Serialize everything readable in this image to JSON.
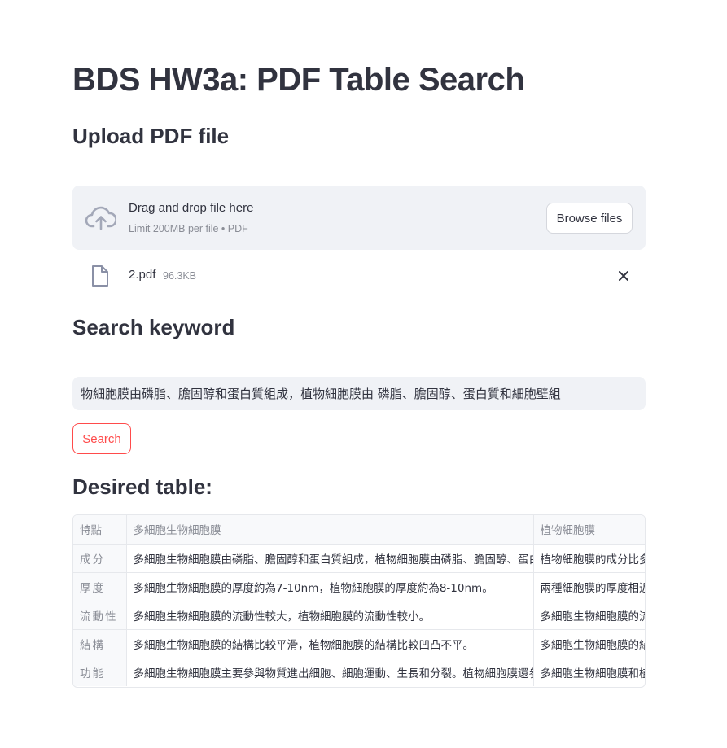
{
  "title": "BDS HW3a: PDF Table Search",
  "upload": {
    "heading": "Upload PDF file",
    "drag_text": "Drag and drop file here",
    "limit_text": "Limit 200MB per file • PDF",
    "browse_label": "Browse files",
    "file_name": "2.pdf",
    "file_size": "96.3KB",
    "icons": {
      "upload": "cloud-upload-icon",
      "file": "file-icon",
      "remove": "close-icon"
    }
  },
  "search": {
    "heading": "Search keyword",
    "value": "物細胞膜由磷脂、膽固醇和蛋白質組成，植物細胞膜由 磷脂、膽固醇、蛋白質和細胞壁組",
    "button_label": "Search"
  },
  "table": {
    "heading": "Desired table:",
    "columns": [
      "特點",
      "多細胞生物細胞膜",
      "植物細胞膜"
    ],
    "rows": [
      [
        "成分",
        "多細胞生物細胞膜由磷脂、膽固醇和蛋白質組成，植物細胞膜由磷脂、膽固醇、蛋白質和細胞壁組成。",
        "植物細胞膜的成分比多細胞生物細胞膜更複雜。"
      ],
      [
        "厚度",
        "多細胞生物細胞膜的厚度約為7-10nm，植物細胞膜的厚度約為8-10nm。",
        "兩種細胞膜的厚度相近。"
      ],
      [
        "流動性",
        "多細胞生物細胞膜的流動性較大，植物細胞膜的流動性較小。",
        "多細胞生物細胞膜的流動性較大。"
      ],
      [
        "結構",
        "多細胞生物細胞膜的結構比較平滑，植物細胞膜的結構比較凹凸不平。",
        "多細胞生物細胞膜的結構比較平滑。"
      ],
      [
        "功能",
        "多細胞生物細胞膜主要參與物質進出細胞、細胞運動、生長和分裂。植物細胞膜還參與保護細胞。",
        "多細胞生物細胞膜和植物細胞膜功能相似。"
      ]
    ]
  },
  "colors": {
    "accent": "#ff4b4b",
    "text": "#31333f",
    "muted": "#8a8d96",
    "panel": "#f0f2f6"
  }
}
